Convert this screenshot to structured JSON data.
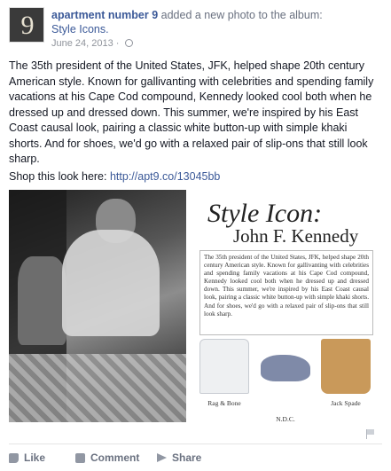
{
  "post": {
    "avatar_glyph": "9",
    "author": "apartment number 9",
    "action": " added a new photo to the album:",
    "album": "Style Icons.",
    "date": "June 24, 2013 · ",
    "privacy_icon": "globe-icon",
    "body": "The 35th president of the United States, JFK, helped shape 20th century American style. Known for gallivanting with celebrities and spending family vacations at his Cape Cod compound, Kennedy looked cool both when he dressed up and dressed down. This summer, we're inspired by his East Coast causal look, pairing a classic white button-up with simple khaki shorts. And for shoes, we'd go with a relaxed pair of slip-ons that still look sharp.",
    "shop_label": "Shop this look here: ",
    "shop_link": "http://apt9.co/13045bb"
  },
  "image": {
    "title": "Style Icon:",
    "name": "John F. Kennedy",
    "body": "The 35th president of the United States, JFK, helped shape 20th century American style. Known for gallivanting with celebrities and spending family vacations at his Cape Cod compound, Kennedy looked cool both when he dressed up and dressed down. This summer, we're inspired by his East Coast causal look, pairing a classic white button-up with simple khaki shorts. And for shoes, we'd go with a relaxed pair of slip-ons that still look sharp.",
    "items": [
      {
        "caption": "Rag & Bone"
      },
      {
        "caption": "N.D.C."
      },
      {
        "caption": "Jack Spade"
      }
    ]
  },
  "actions": {
    "like": "Like",
    "comment": "Comment",
    "share": "Share"
  },
  "colors": {
    "link": "#3b5998",
    "muted": "#6a7180"
  }
}
